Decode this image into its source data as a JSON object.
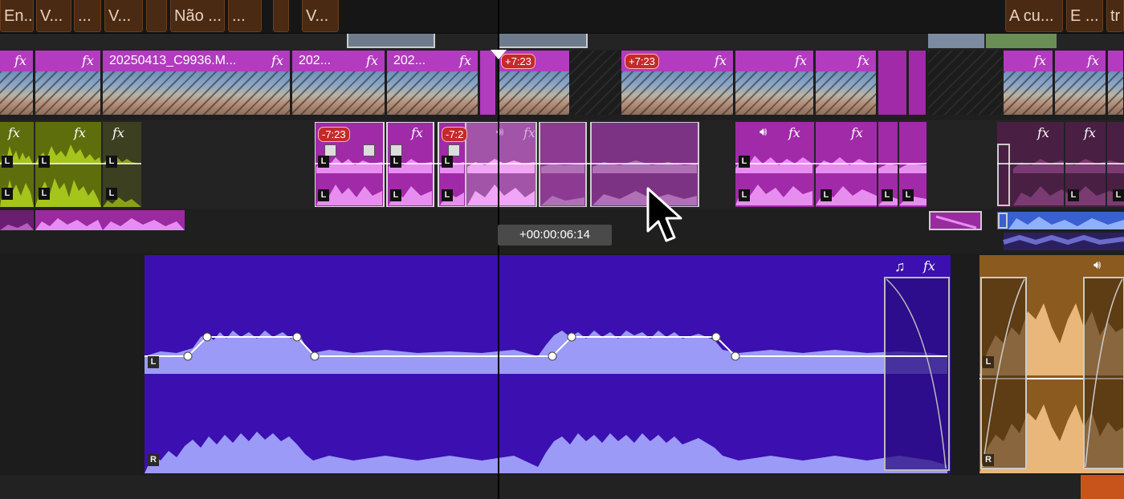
{
  "markers": {
    "left": [
      "En...",
      "V...",
      "...",
      "V...",
      "",
      "Não ...",
      "...",
      "",
      "V..."
    ],
    "right": [
      "A cu...",
      "E ...",
      "tr"
    ]
  },
  "video_track": {
    "fx_label": "fx",
    "clip_names": [
      "20250413_C9936.M...",
      "202...",
      "202..."
    ],
    "speed_badges": [
      "+7:23",
      "+7:23"
    ]
  },
  "audio_track": {
    "fx_label": "fx",
    "channel_labels": {
      "left": "L",
      "right": "R"
    },
    "speed_badges": [
      "-7:23",
      "-7:2"
    ]
  },
  "timecode_tooltip": "+00:00:06:14",
  "music_clip": {
    "fx_label": "fx",
    "music_icon": "music-note-icon"
  },
  "colors": {
    "video_clip_header": "#b23bbf",
    "audio_green": "#a5c41c",
    "audio_magenta": "#a02aa8",
    "music_purple": "#3b0fb0",
    "music_waveform": "#9b9af6",
    "orange_clip": "#8a5a1e",
    "playhead": "#000000"
  }
}
